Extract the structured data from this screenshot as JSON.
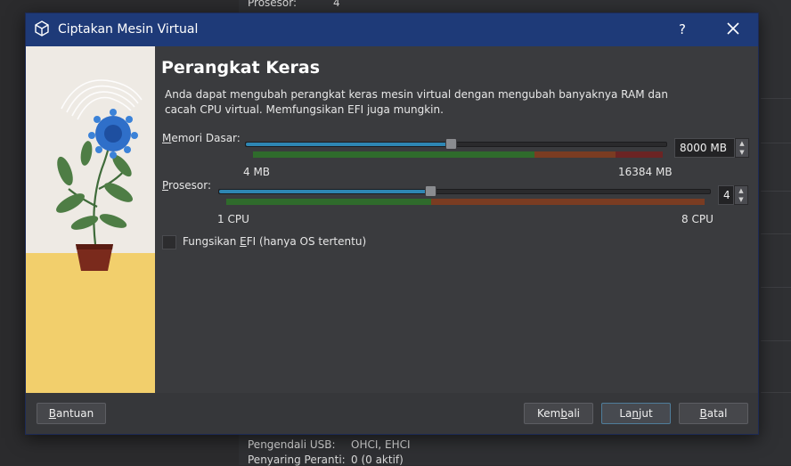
{
  "background": {
    "top_row": {
      "label": "Prosesor:",
      "value": "4"
    },
    "bottom_rows": [
      {
        "label": "Pengendali USB:",
        "value": "OHCI, EHCI"
      },
      {
        "label": "Penyaring Peranti:",
        "value": "0 (0 aktif)"
      }
    ]
  },
  "dialog": {
    "title": "Ciptakan Mesin Virtual",
    "help_label": "?",
    "heading": "Perangkat Keras",
    "description": "Anda dapat mengubah perangkat keras mesin virtual dengan mengubah banyaknya RAM dan cacah CPU virtual. Memfungsikan EFI juga mungkin.",
    "memory": {
      "label_prefix": "M",
      "label_rest": "emori Dasar:",
      "value": "8000 MB",
      "min_label": "4 MB",
      "max_label": "16384 MB",
      "fraction": 0.488
    },
    "processor": {
      "label_prefix": "P",
      "label_rest": "rosesor:",
      "value": "4",
      "min_label": "1 CPU",
      "max_label": "8 CPU",
      "fraction": 0.43
    },
    "efi": {
      "label_before": "Fungsikan ",
      "label_u": "E",
      "label_after": "FI (hanya OS tertentu)",
      "checked": false
    },
    "buttons": {
      "help": {
        "u": "B",
        "rest": "antuan"
      },
      "back": {
        "before": "Kem",
        "u": "b",
        "after": "ali"
      },
      "next": {
        "before": "La",
        "u": "n",
        "after": "jut"
      },
      "cancel": {
        "u": "B",
        "rest": "atal"
      }
    }
  },
  "colors": {
    "titlebar": "#1e3a78",
    "slider_fill": "#2e86b3",
    "scale_green": "#2f6b2c",
    "scale_red": "#7a3c22",
    "scale_darkred": "#6b2424"
  }
}
